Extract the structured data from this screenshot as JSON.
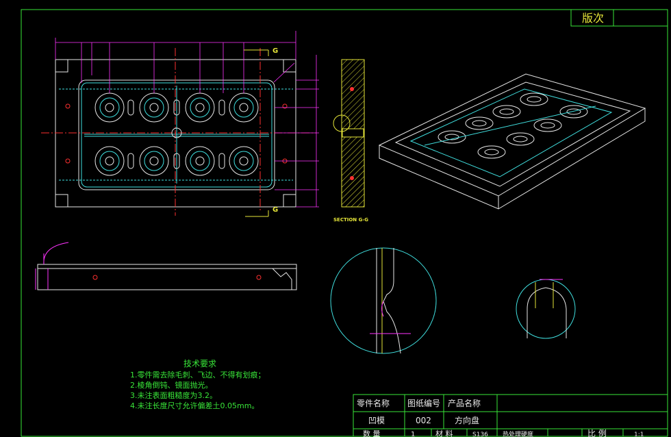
{
  "revision_label": "版次",
  "markers": {
    "section_top": "G",
    "section_bottom": "G",
    "section_caption": "SECTION G-G"
  },
  "tech_requirements": {
    "title": "技术要求",
    "items": [
      "1.零件需去除毛刺、飞边、不得有划痕；",
      "2.棱角倒钝、镜面抛光。",
      "3.未注表面粗糙度为3.2。",
      "4.未注长度尺寸允许偏差土0.05mm。"
    ]
  },
  "title_block": {
    "headers": [
      "零件名称",
      "图纸编号",
      "产品名称"
    ],
    "values": [
      "凹模",
      "002",
      "方向盘"
    ],
    "bottom_row": {
      "qty_label": "数 量",
      "qty_value": "1",
      "material_label": "材 料",
      "material_value": "S136",
      "hardness_label": "热处理硬度",
      "scale_label": "比 例",
      "scale_value": "1:1"
    }
  },
  "colors": {
    "frame": "#39e639",
    "outline": "#e8e8e8",
    "cavity": "#40e0e0",
    "dimension": "#ff33ff",
    "center_line": "#ff3030",
    "section": "#e6e639"
  }
}
